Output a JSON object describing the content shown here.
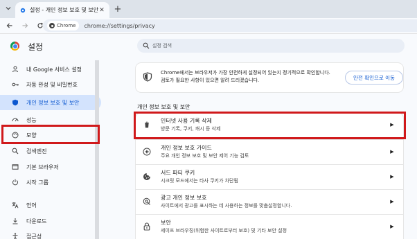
{
  "browser": {
    "tab_title": "설정 - 개인 정보 보호 및 보안",
    "address_chip": "Chrome",
    "url": "chrome://settings/privacy"
  },
  "settings": {
    "title": "설정",
    "search_placeholder": "설정 검색"
  },
  "sidebar": {
    "items": [
      {
        "label": "내 Google 서비스 설정",
        "icon": "person-icon"
      },
      {
        "label": "자동 완성 및 비밀번호",
        "icon": "key-icon"
      },
      {
        "label": "개인 정보 보호 및 보안",
        "icon": "shield-icon",
        "active": true
      },
      {
        "label": "성능",
        "icon": "performance-icon"
      },
      {
        "label": "모양",
        "icon": "palette-icon"
      },
      {
        "label": "검색엔진",
        "icon": "search-icon"
      },
      {
        "label": "기본 브라우저",
        "icon": "browser-icon"
      },
      {
        "label": "시작 그룹",
        "icon": "power-icon"
      },
      {
        "label": "언어",
        "icon": "translate-icon"
      },
      {
        "label": "다운로드",
        "icon": "download-icon"
      },
      {
        "label": "접근성",
        "icon": "accessibility-icon"
      }
    ]
  },
  "safety_card": {
    "text": "Chrome에서는 브라우저가 가장 안전하게 설정되어 있는지 정기적으로 확인합니다. 검토가 필요한 사항이 있으면 알려 드리겠습니다.",
    "button": "안전 확인으로 이동"
  },
  "privacy_section": {
    "title": "개인 정보 보호 및 보안",
    "rows": [
      {
        "title": "인터넷 사용 기록 삭제",
        "subtitle": "방문 기록, 쿠키, 캐시 등 삭제",
        "icon": "trash-icon"
      },
      {
        "title": "개인 정보 보호 가이드",
        "subtitle": "주요 개인 정보 보호 및 보안 제어 기능 검토",
        "icon": "compass-icon"
      },
      {
        "title": "서드 파티 쿠키",
        "subtitle": "시크릿 모드에서는 타사 쿠키가 차단됨",
        "icon": "cookie-icon"
      },
      {
        "title": "광고 개인 정보 보호",
        "subtitle": "사이트에서 광고를 표시하는 데 사용하는 정보를 맞춤설정합니다.",
        "icon": "ads-privacy-icon"
      },
      {
        "title": "보안",
        "subtitle": "세이프 브라우징(위험한 사이트로부터 보호) 및 기타 보안 설정",
        "icon": "lock-icon"
      }
    ]
  },
  "colors": {
    "highlight": "#d0191b",
    "accent": "#0b57d0",
    "active_bg": "#d3e3fd"
  }
}
